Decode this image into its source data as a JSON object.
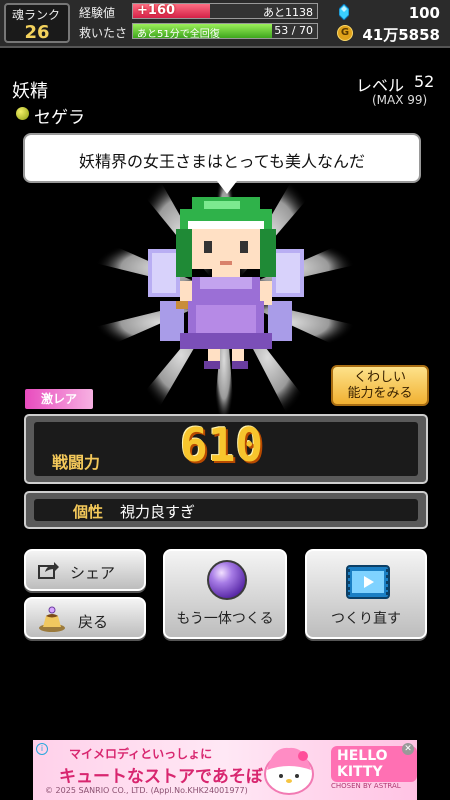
{
  "header": {
    "rank_label": "魂ランク",
    "rank_value": "26",
    "exp_label": "経験値",
    "exp_gain": "+160",
    "exp_remaining": "あと1138",
    "exp_progress": 0.42,
    "save_label": "救いたさ",
    "save_recovery": "あと51分で全回復",
    "save_value": "53 / 70",
    "save_progress": 0.757,
    "gem_icon": "gem-icon",
    "gem_value": "100",
    "coin_icon": "coin-icon",
    "coin_value": "41万5858"
  },
  "character": {
    "type": "妖精",
    "name": "セゲラ",
    "level_label": "レベル",
    "level_value": "52",
    "level_max": "(MAX 99)",
    "speech": "妖精界の女王さまはとっても美人なんだ",
    "rarity": "激レア",
    "detail_button": [
      "くわしい",
      "能力をみる"
    ]
  },
  "stats": {
    "power_label": "戦闘力",
    "power_value": "610",
    "trait_label": "個性",
    "trait_value": "視力良すぎ"
  },
  "buttons": {
    "share": "シェア",
    "back": "戻る",
    "make_another": "もう一体つくる",
    "remake": "つくり直す"
  },
  "ad": {
    "line1": "マイメロディといっしょに",
    "line2": "キュートなストアであそぼうよ!",
    "copyright": "© 2025 SANRIO CO., LTD. (Appl.No.KHK24001977)",
    "brand": "HELLO KITTY",
    "brand_sub": "CHOSEN BY ASTRAL"
  },
  "colors": {
    "accent_gold": "#f7c52d",
    "exp_bar": "#d42248",
    "save_bar": "#3ea61e",
    "rarity": "#e84cbe"
  }
}
